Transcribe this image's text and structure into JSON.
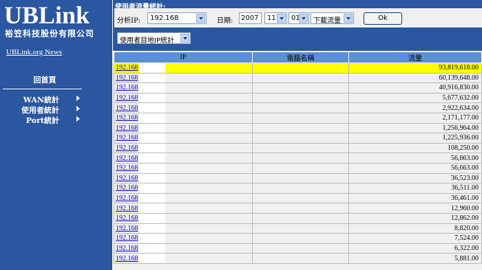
{
  "brand": {
    "logo": "UBLink",
    "company": "裕笠科技股份有限公司",
    "news_link": "UBLink.org News"
  },
  "sidebar": {
    "home": "回首頁",
    "items": [
      {
        "label": "WAN統計"
      },
      {
        "label": "使用者統計"
      },
      {
        "label": "Port統計"
      }
    ]
  },
  "header": {
    "title": "使用者流量統計:"
  },
  "filters": {
    "ip_label": "分析IP:",
    "ip_value": "192.168",
    "date_label": "日期:",
    "year": "2007",
    "month": "11",
    "day": "01",
    "direction": "下載流量",
    "ok_label": "Ok",
    "mode": "使用者目地IP統計"
  },
  "table": {
    "columns": [
      "IP",
      "電腦名稱",
      "流量"
    ],
    "rows": [
      {
        "ip": "192.168",
        "name": "",
        "traffic": "93,819,618.00",
        "highlighted": true
      },
      {
        "ip": "192.168",
        "name": "",
        "traffic": "60,139,648.00"
      },
      {
        "ip": "192.168",
        "name": "",
        "traffic": "40,916,830.00"
      },
      {
        "ip": "192.168",
        "name": "",
        "traffic": "5,677,632.00"
      },
      {
        "ip": "192.168",
        "name": "",
        "traffic": "2,922,634.00"
      },
      {
        "ip": "192.168",
        "name": "",
        "traffic": "2,171,177.00"
      },
      {
        "ip": "192.168",
        "name": "",
        "traffic": "1,256,964.00"
      },
      {
        "ip": "192.168",
        "name": "",
        "traffic": "1,225,936.00"
      },
      {
        "ip": "192.168",
        "name": "",
        "traffic": "108,250.00"
      },
      {
        "ip": "192.168",
        "name": "",
        "traffic": "56,863.00"
      },
      {
        "ip": "192.168",
        "name": "",
        "traffic": "56,663.00"
      },
      {
        "ip": "192.168",
        "name": "",
        "traffic": "36,523.00"
      },
      {
        "ip": "192.168",
        "name": "",
        "traffic": "36,511.00"
      },
      {
        "ip": "192.168",
        "name": "",
        "traffic": "36,461.00"
      },
      {
        "ip": "192.168",
        "name": "",
        "traffic": "12,960.00"
      },
      {
        "ip": "192.168",
        "name": "",
        "traffic": "12,862.00"
      },
      {
        "ip": "192.168",
        "name": "",
        "traffic": "8,820.00"
      },
      {
        "ip": "192.168",
        "name": "",
        "traffic": "7,524.00"
      },
      {
        "ip": "192.168",
        "name": "",
        "traffic": "6,322.00"
      },
      {
        "ip": "192.168",
        "name": "",
        "traffic": "5,881.00"
      }
    ]
  },
  "colors": {
    "sidebar_bg": "#2b56a0",
    "highlight": "#ffff00",
    "header_bg": "#5b8fd8",
    "link": "#0000cc"
  }
}
